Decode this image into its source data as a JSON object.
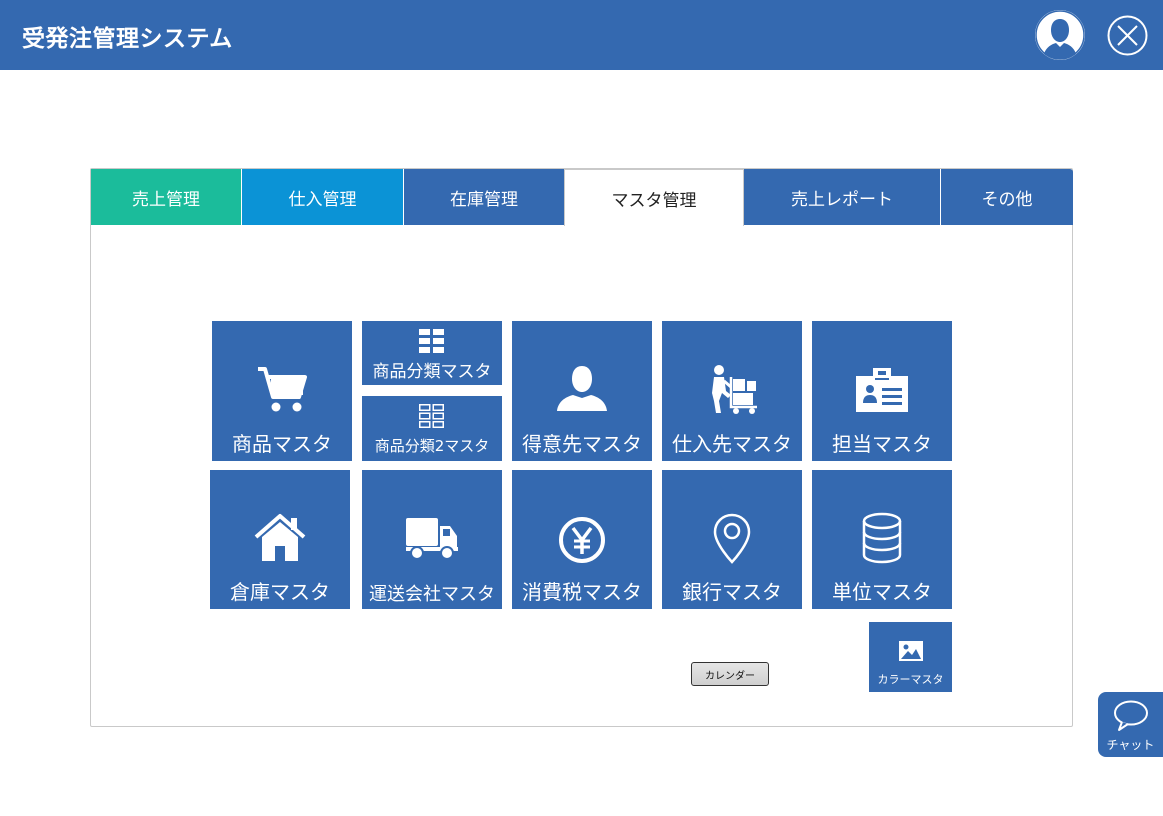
{
  "header": {
    "title": "受発注管理システム",
    "icons": {
      "user": "user-avatar-icon",
      "close": "close-circle-icon"
    }
  },
  "tabs": [
    {
      "label": "売上管理",
      "color": "#1bbc9b"
    },
    {
      "label": "仕入管理",
      "color": "#0b93d6"
    },
    {
      "label": "在庫管理",
      "color": "#3469b0"
    },
    {
      "label": "マスタ管理",
      "color": "#ffffff",
      "active": true
    },
    {
      "label": "売上レポート",
      "color": "#3469b0"
    },
    {
      "label": "その他",
      "color": "#3469b0"
    }
  ],
  "tiles": {
    "product": {
      "label": "商品マスタ",
      "icon": "cart-icon"
    },
    "category": {
      "label": "商品分類マスタ",
      "icon": "grid-icon"
    },
    "category2": {
      "label": "商品分類2マスタ",
      "icon": "grid-outline-icon"
    },
    "customer": {
      "label": "得意先マスタ",
      "icon": "person-icon"
    },
    "supplier": {
      "label": "仕入先マスタ",
      "icon": "delivery-person-icon"
    },
    "staff": {
      "label": "担当マスタ",
      "icon": "id-card-icon"
    },
    "warehouse": {
      "label": "倉庫マスタ",
      "icon": "house-icon"
    },
    "shipping": {
      "label": "運送会社マスタ",
      "icon": "truck-icon"
    },
    "tax": {
      "label": "消費税マスタ",
      "icon": "yen-icon"
    },
    "bank": {
      "label": "銀行マスタ",
      "icon": "map-pin-icon"
    },
    "unit": {
      "label": "単位マスタ",
      "icon": "database-icon"
    },
    "color": {
      "label": "カラーマスタ",
      "icon": "image-icon"
    }
  },
  "calendar_button": {
    "label": "カレンダー"
  },
  "chat": {
    "label": "チャット",
    "icon": "chat-bubble-icon"
  },
  "colors": {
    "brand": "#3469b0",
    "sales": "#1bbc9b",
    "purchase": "#0b93d6"
  }
}
